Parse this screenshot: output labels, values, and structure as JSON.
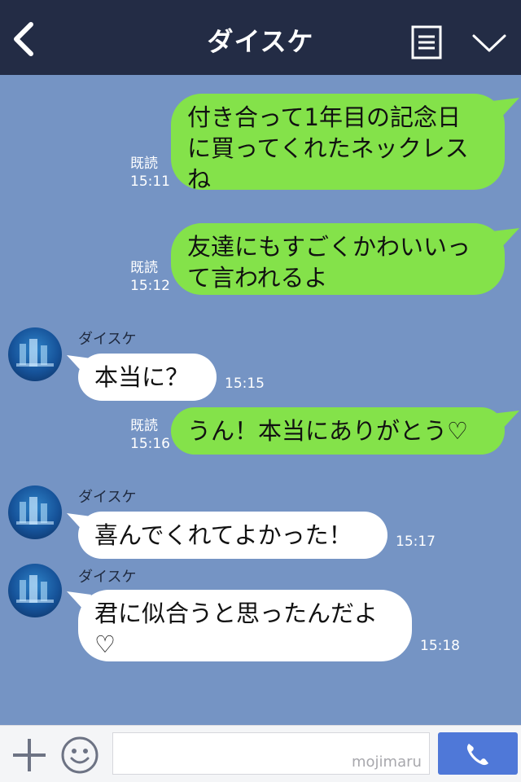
{
  "header": {
    "title": "ダイスケ"
  },
  "messages": [
    {
      "side": "out",
      "lines": [
        "付き合って1年目の記念日",
        "に買ってくれたネックレス",
        "ね"
      ],
      "read": "既読",
      "time": "15:11"
    },
    {
      "side": "out",
      "lines": [
        "友達にもすごくかわいいっ",
        "て言われるよ"
      ],
      "read": "既読",
      "time": "15:12"
    },
    {
      "side": "in",
      "sender": "ダイスケ",
      "lines": [
        "本当に？"
      ],
      "time": "15:15"
    },
    {
      "side": "out",
      "lines": [
        "うん！本当にありがとう♡"
      ],
      "read": "既読",
      "time": "15:16"
    },
    {
      "side": "in",
      "sender": "ダイスケ",
      "lines": [
        "喜んでくれてよかった！"
      ],
      "time": "15:17"
    },
    {
      "side": "in",
      "sender": "ダイスケ",
      "lines": [
        "君に似合うと思ったんだよ",
        "♡"
      ],
      "time": "15:18"
    }
  ],
  "footer": {
    "input_value": "",
    "watermark": "mojimaru"
  },
  "icons": {
    "back": "chevron-left-icon",
    "menu": "list-icon",
    "collapse": "chevron-down-icon",
    "add": "plus-icon",
    "emoji": "smiley-icon",
    "call": "phone-icon"
  },
  "colors": {
    "header_bg": "#232c45",
    "chat_bg": "#7594c4",
    "outgoing_bubble": "#84e24a",
    "incoming_bubble": "#ffffff",
    "call_button": "#4f78d8"
  }
}
